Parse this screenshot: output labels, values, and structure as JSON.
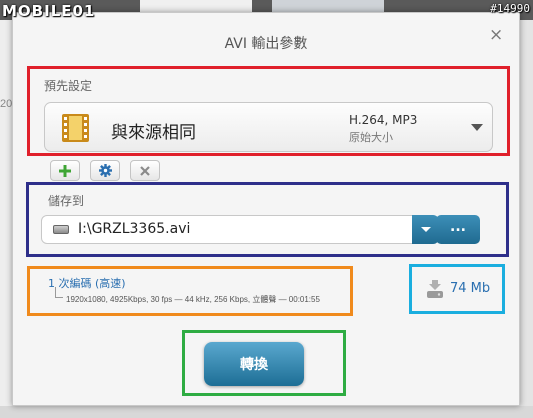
{
  "watermark": {
    "logo": "MOBILE01",
    "id": "#14990"
  },
  "background": {
    "left_text": "20"
  },
  "dialog": {
    "title": "AVI 輸出參數",
    "close_glyph": "×"
  },
  "preset": {
    "label": "預先設定",
    "name": "與來源相同",
    "codec": "H.264, MP3",
    "size_note": "原始大小",
    "icon": "film-icon"
  },
  "preset_actions": [
    {
      "name": "add",
      "icon": "plus-icon",
      "color": "#3fa535"
    },
    {
      "name": "settings",
      "icon": "gear-icon",
      "color": "#2a6fb0"
    },
    {
      "name": "remove",
      "icon": "close-icon",
      "color": "#8a8a8a"
    }
  ],
  "save": {
    "label": "儲存到",
    "path": "I:\\GRZL3365.avi",
    "browse_label": "..."
  },
  "encode": {
    "title": "1 次編碼 (高速)",
    "detail": "1920x1080, 4925Kbps, 30 fps — 44 kHz, 256 Kbps, 立體聲 — 00:01:55"
  },
  "size": {
    "value": "74 Mb",
    "icon": "file-size-icon"
  },
  "convert": {
    "label": "轉換"
  },
  "highlight_colors": {
    "red": "#e0202b",
    "navy": "#2e2f8a",
    "orange": "#f08a1c",
    "cyan": "#1aaedf",
    "green": "#2eac42"
  }
}
